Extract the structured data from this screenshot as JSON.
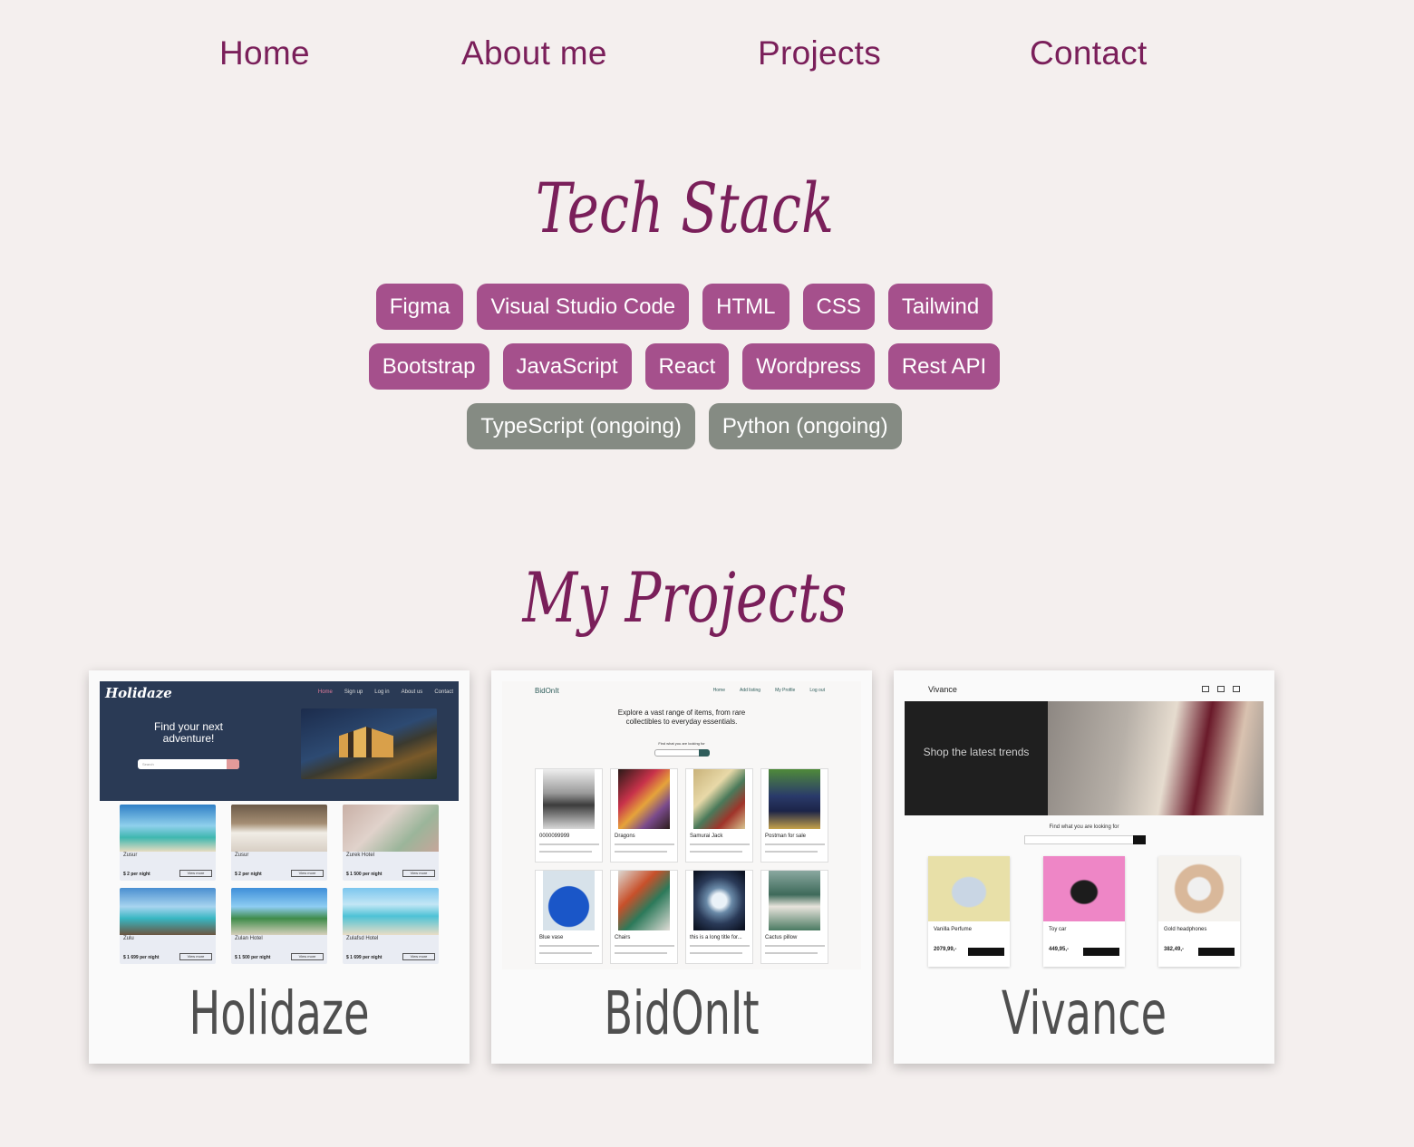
{
  "nav": {
    "home": "Home",
    "about": "About me",
    "projects": "Projects",
    "contact": "Contact"
  },
  "tech": {
    "title": "Tech Stack",
    "row1": [
      "Figma",
      "Visual Studio Code",
      "HTML",
      "CSS",
      "Tailwind"
    ],
    "row2": [
      "Bootstrap",
      "JavaScript",
      "React",
      "Wordpress",
      "Rest API"
    ],
    "row3": [
      "TypeScript (ongoing)",
      "Python (ongoing)"
    ]
  },
  "projects": {
    "title": "My Projects",
    "items": [
      {
        "name": "Holidaze",
        "shot": {
          "logo": "Holidaze",
          "links": [
            "Home",
            "Sign up",
            "Log in",
            "About us",
            "Contact"
          ],
          "tagline": "Find your next adventure!",
          "search_placeholder": "Search",
          "venues": [
            {
              "name": "Zusur",
              "price": "$ 2 per night",
              "button": "View more"
            },
            {
              "name": "Zusur",
              "price": "$ 2 per night",
              "button": "View more"
            },
            {
              "name": "Zurek Hotel",
              "price": "$ 1 500 per night",
              "button": "View more"
            },
            {
              "name": "Zulu",
              "price": "$ 1 699 per night",
              "button": "View more"
            },
            {
              "name": "Zulan Hotel",
              "price": "$ 1 500 per night",
              "button": "View more"
            },
            {
              "name": "Zulafsd Hotel",
              "price": "$ 1 699 per night",
              "button": "View more"
            }
          ]
        }
      },
      {
        "name": "BidOnIt",
        "shot": {
          "logo": "BidOnIt",
          "links": [
            "Home",
            "Add listing",
            "My Profile",
            "Log out"
          ],
          "tagline": "Explore a vast range of items, from rare collectibles to everyday essentials.",
          "find": "Find what you are looking for",
          "listings": [
            "0000099999",
            "Dragons",
            "Samurai Jack",
            "Postman for sale",
            "Blue vase",
            "Chairs",
            "this is a long title for...",
            "Cactus pillow"
          ]
        }
      },
      {
        "name": "Vivance",
        "shot": {
          "logo": "Vivance",
          "hero": "Shop the latest trends",
          "find": "Find what you are looking for",
          "products": [
            {
              "name": "Vanilla Perfume",
              "price": "2079,99,-"
            },
            {
              "name": "Toy car",
              "price": "449,95,-"
            },
            {
              "name": "Gold headphones",
              "price": "382,49,-"
            }
          ]
        }
      }
    ]
  },
  "colors": {
    "background": "#f4efee",
    "accent": "#7a1f5a",
    "chip": "#a5508c",
    "chip_ongoing": "#858b83"
  }
}
